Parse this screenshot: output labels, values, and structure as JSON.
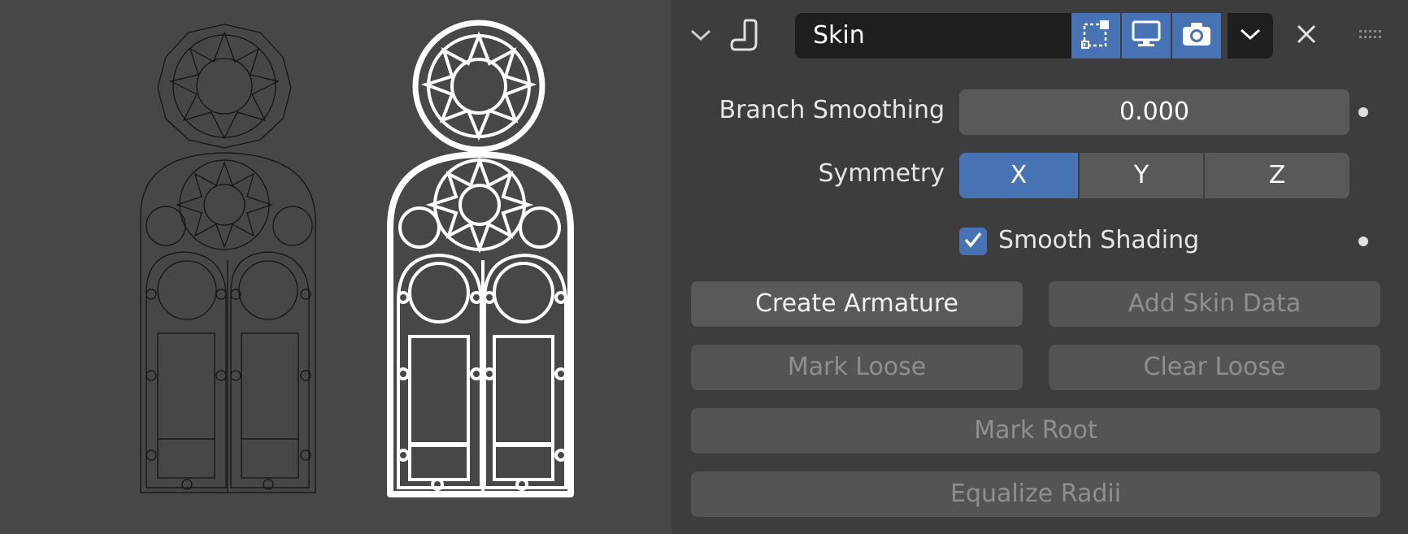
{
  "modifier": {
    "name": "Skin",
    "icons": {
      "collapse": "chevron-down-icon",
      "modifier_type": "skin-modifier-icon",
      "edit_mode": "edit-mode-icon",
      "viewport": "monitor-icon",
      "render": "camera-icon",
      "dropdown": "chevron-down-icon",
      "close": "close-icon",
      "drag": "grip-icon"
    },
    "colors": {
      "accent": "#4772b3",
      "field": "#595959",
      "panel": "#3d3d3d",
      "dark_field": "#1e1e1e"
    }
  },
  "properties": {
    "branch_smoothing": {
      "label": "Branch Smoothing",
      "value": "0.000"
    },
    "symmetry": {
      "label": "Symmetry",
      "axes": [
        "X",
        "Y",
        "Z"
      ],
      "active": "X"
    },
    "smooth_shading": {
      "label": "Smooth Shading",
      "checked": true
    }
  },
  "operators": {
    "create_armature": "Create Armature",
    "add_skin_data": "Add Skin Data",
    "mark_loose": "Mark Loose",
    "clear_loose": "Clear Loose",
    "mark_root": "Mark Root",
    "equalize_radii": "Equalize Radii"
  }
}
